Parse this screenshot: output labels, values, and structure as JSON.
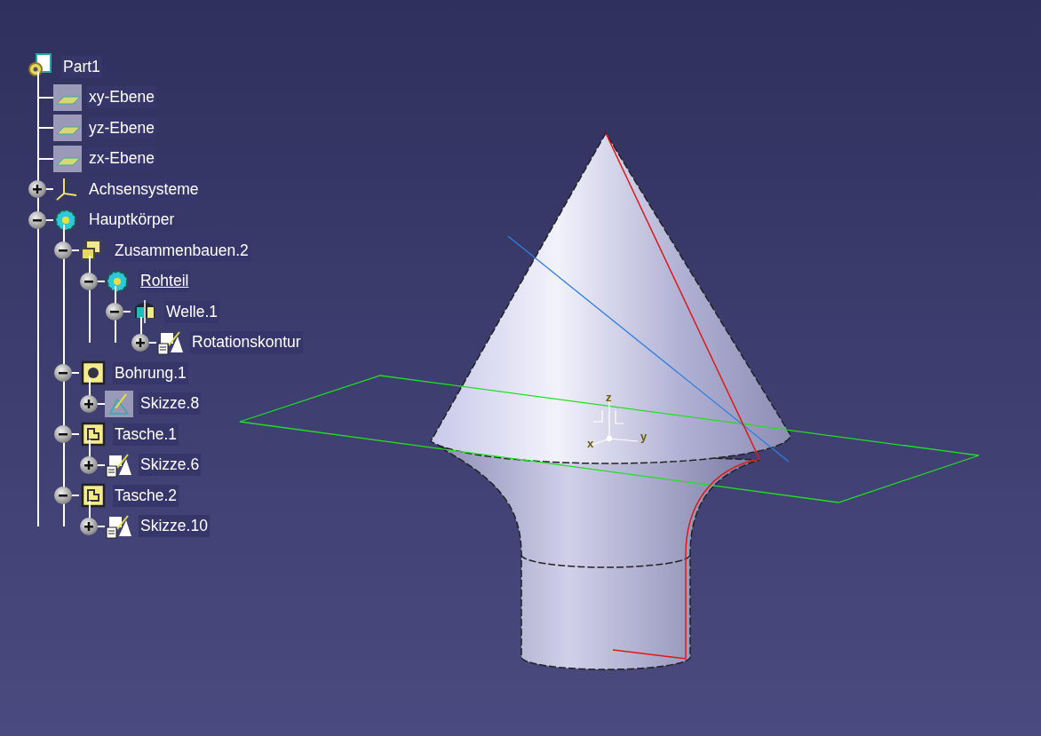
{
  "tree": {
    "label": "Part1",
    "kind": "part",
    "in_work": false,
    "children": [
      {
        "label": "xy-Ebene",
        "kind": "plane",
        "in_work": false
      },
      {
        "label": "yz-Ebene",
        "kind": "plane",
        "in_work": false
      },
      {
        "label": "zx-Ebene",
        "kind": "plane",
        "in_work": false
      },
      {
        "label": "Achsensysteme",
        "kind": "axis",
        "expanded": false,
        "in_work": false
      },
      {
        "label": "Hauptkörper",
        "kind": "body",
        "expanded": true,
        "in_work": false,
        "children": [
          {
            "label": "Zusammenbauen.2",
            "kind": "assembly",
            "expanded": true,
            "in_work": false,
            "children": [
              {
                "label": "Rohteil",
                "kind": "body",
                "expanded": true,
                "in_work": true,
                "children": [
                  {
                    "label": "Welle.1",
                    "kind": "shaft",
                    "expanded": true,
                    "in_work": false,
                    "children": [
                      {
                        "label": "Rotationskontur",
                        "kind": "sketch",
                        "expanded": false,
                        "in_work": false
                      }
                    ]
                  }
                ]
              }
            ]
          },
          {
            "label": "Bohrung.1",
            "kind": "hole",
            "expanded": true,
            "in_work": false,
            "children": [
              {
                "label": "Skizze.8",
                "kind": "hidden_sketch",
                "expanded": false,
                "in_work": false
              }
            ]
          },
          {
            "label": "Tasche.1",
            "kind": "pocket",
            "expanded": true,
            "in_work": false,
            "children": [
              {
                "label": "Skizze.6",
                "kind": "sketch",
                "expanded": false,
                "in_work": false
              }
            ]
          },
          {
            "label": "Tasche.2",
            "kind": "pocket",
            "expanded": true,
            "in_work": false,
            "children": [
              {
                "label": "Skizze.10",
                "kind": "sketch",
                "expanded": false,
                "in_work": false
              }
            ]
          }
        ]
      }
    ]
  },
  "viewport": {
    "axis_labels": [
      "z",
      "x",
      "y"
    ]
  }
}
